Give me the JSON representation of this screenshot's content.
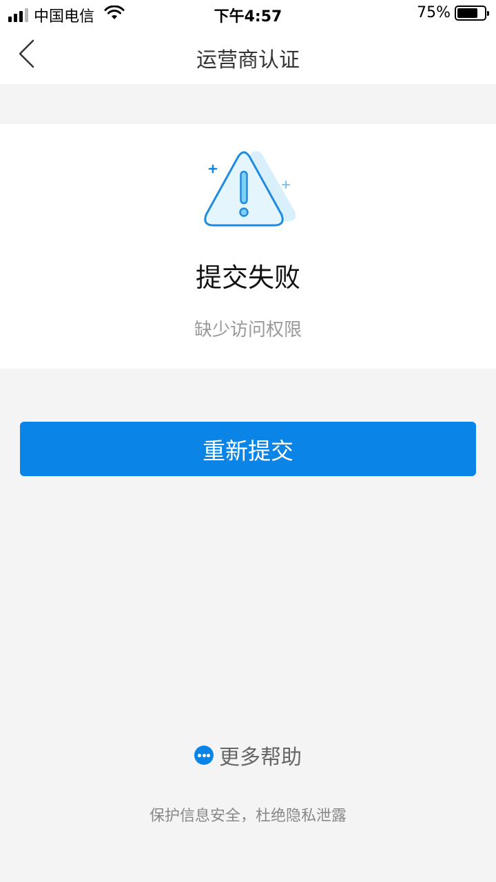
{
  "status_bar": {
    "carrier": "中国电信",
    "time": "下午4:57",
    "battery_label": "75%",
    "battery_level": 0.75
  },
  "nav": {
    "title": "运营商认证",
    "back_icon": "chevron-left-icon"
  },
  "result": {
    "icon": "warning-triangle-icon",
    "title": "提交失败",
    "description": "缺少访问权限"
  },
  "actions": {
    "resubmit_label": "重新提交"
  },
  "help": {
    "icon": "more-dots-icon",
    "label": "更多帮助"
  },
  "footer": {
    "note": "保护信息安全，杜绝隐私泄露"
  },
  "colors": {
    "accent": "#0a84e6",
    "background": "#f4f4f4",
    "icon_fill": "#d9f0fc"
  }
}
